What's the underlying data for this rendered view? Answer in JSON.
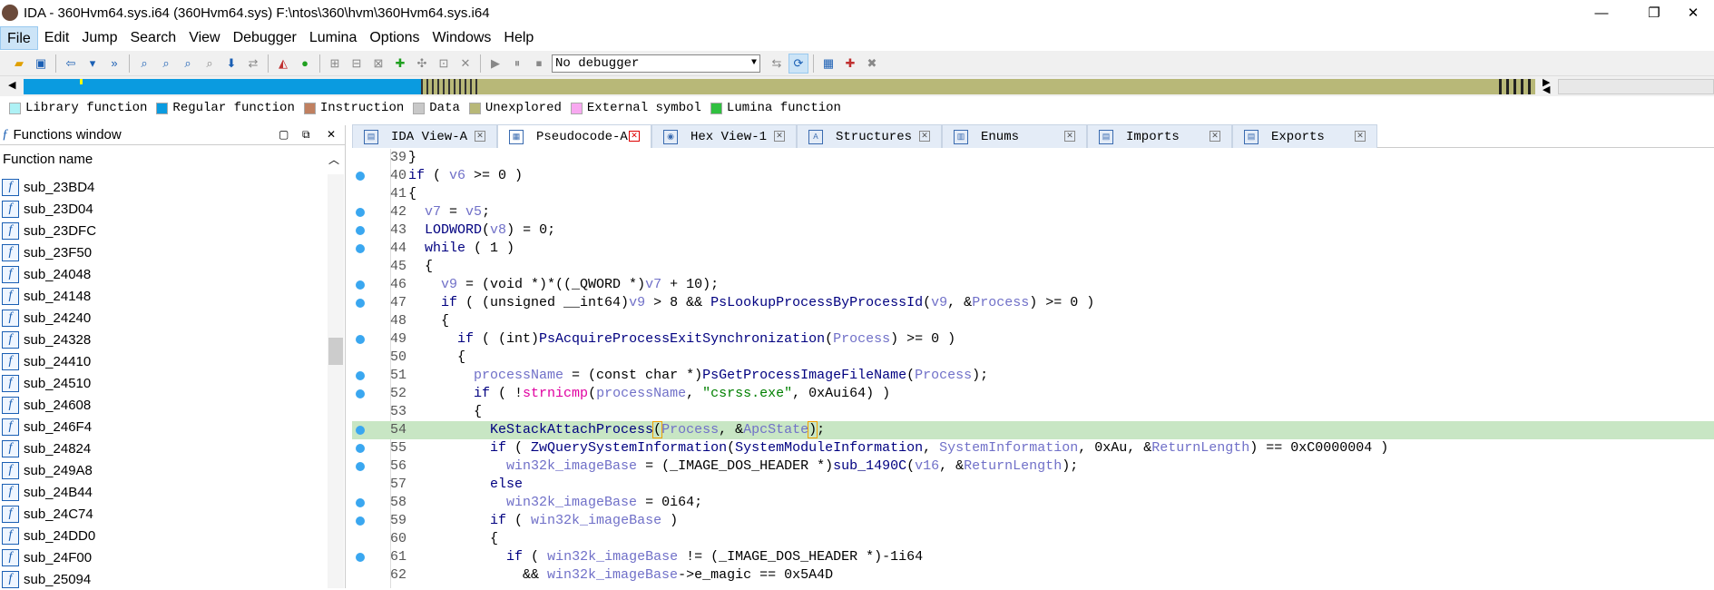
{
  "window": {
    "title": "IDA - 360Hvm64.sys.i64 (360Hvm64.sys) F:\\ntos\\360\\hvm\\360Hvm64.sys.i64",
    "minimize": "—",
    "maximize": "❐",
    "close": "✕"
  },
  "menu": [
    "File",
    "Edit",
    "Jump",
    "Search",
    "View",
    "Debugger",
    "Lumina",
    "Options",
    "Windows",
    "Help"
  ],
  "toolbar": {
    "debugger_select": "No debugger"
  },
  "legend": [
    {
      "label": "Library function",
      "color": "#aef1f5"
    },
    {
      "label": "Regular function",
      "color": "#0a9be0"
    },
    {
      "label": "Instruction",
      "color": "#c08060"
    },
    {
      "label": "Data",
      "color": "#c8c8c8"
    },
    {
      "label": "Unexplored",
      "color": "#b8b878"
    },
    {
      "label": "External symbol",
      "color": "#f8a8f0"
    },
    {
      "label": "Lumina function",
      "color": "#30c040"
    }
  ],
  "functions_window": {
    "title": "Functions window",
    "column": "Function name",
    "items": [
      "sub_23BD4",
      "sub_23D04",
      "sub_23DFC",
      "sub_23F50",
      "sub_24048",
      "sub_24148",
      "sub_24240",
      "sub_24328",
      "sub_24410",
      "sub_24510",
      "sub_24608",
      "sub_246F4",
      "sub_24824",
      "sub_249A8",
      "sub_24B44",
      "sub_24C74",
      "sub_24DD0",
      "sub_24F00",
      "sub_25094"
    ]
  },
  "tabs": [
    {
      "label": "IDA View-A",
      "active": false
    },
    {
      "label": "Pseudocode-A",
      "active": true
    },
    {
      "label": "Hex View-1",
      "active": false
    },
    {
      "label": "Structures",
      "active": false
    },
    {
      "label": "Enums",
      "active": false
    },
    {
      "label": "Imports",
      "active": false
    },
    {
      "label": "Exports",
      "active": false
    }
  ],
  "code_lines": [
    {
      "n": "39",
      "dot": false,
      "html": "}"
    },
    {
      "n": "40",
      "dot": true,
      "html": "<span class='kw'>if</span> ( <span class='vr'>v6</span> &gt;= 0 )"
    },
    {
      "n": "41",
      "dot": false,
      "html": "{"
    },
    {
      "n": "42",
      "dot": true,
      "html": "  <span class='vr'>v7</span> = <span class='vr'>v5</span>;"
    },
    {
      "n": "43",
      "dot": true,
      "html": "  <span class='fnn'>LODWORD</span>(<span class='vr'>v8</span>) = 0;"
    },
    {
      "n": "44",
      "dot": true,
      "html": "  <span class='kw'>while</span> ( 1 )"
    },
    {
      "n": "45",
      "dot": false,
      "html": "  {"
    },
    {
      "n": "46",
      "dot": true,
      "html": "    <span class='vr'>v9</span> = (void *)*((_QWORD *)<span class='vr'>v7</span> + 10);"
    },
    {
      "n": "47",
      "dot": true,
      "html": "    <span class='kw'>if</span> ( (unsigned __int64)<span class='vr'>v9</span> &gt; 8 &amp;&amp; <span class='fnn'>PsLookupProcessByProcessId</span>(<span class='vr'>v9</span>, &amp;<span class='vr'>Process</span>) &gt;= 0 )"
    },
    {
      "n": "48",
      "dot": false,
      "html": "    {"
    },
    {
      "n": "49",
      "dot": true,
      "html": "      <span class='kw'>if</span> ( (int)<span class='fnn'>PsAcquireProcessExitSynchronization</span>(<span class='vr'>Process</span>) &gt;= 0 )"
    },
    {
      "n": "50",
      "dot": false,
      "html": "      {"
    },
    {
      "n": "51",
      "dot": true,
      "html": "        <span class='vr'>processName</span> = (const char *)<span class='fnn'>PsGetProcessImageFileName</span>(<span class='vr'>Process</span>);"
    },
    {
      "n": "52",
      "dot": true,
      "html": "        <span class='kw'>if</span> ( !<span class='pk'>strnicmp</span>(<span class='vr'>processName</span>, <span class='st'>\"csrss.exe\"</span>, 0xAui64) )"
    },
    {
      "n": "53",
      "dot": false,
      "html": "        {"
    },
    {
      "n": "54",
      "dot": true,
      "hl": true,
      "html": "          <span class='fnn'>KeStackAttachProcess</span><span class='cur'>(</span><span class='vr'>Process</span>, &amp;<span class='vr'>ApcState</span><span class='cur'>)</span>;"
    },
    {
      "n": "55",
      "dot": true,
      "html": "          <span class='kw'>if</span> ( <span class='fnn'>ZwQuerySystemInformation</span>(<span class='fnn'>SystemModuleInformation</span>, <span class='vr'>SystemInformation</span>, 0xAu, &amp;<span class='vr'>ReturnLength</span>) == 0xC0000004 )"
    },
    {
      "n": "56",
      "dot": true,
      "html": "            <span class='vr'>win32k_imageBase</span> = (_IMAGE_DOS_HEADER *)<span class='fnn'>sub_1490C</span>(<span class='vr'>v16</span>, &amp;<span class='vr'>ReturnLength</span>);"
    },
    {
      "n": "57",
      "dot": false,
      "html": "          <span class='kw'>else</span>"
    },
    {
      "n": "58",
      "dot": true,
      "html": "            <span class='vr'>win32k_imageBase</span> = 0i64;"
    },
    {
      "n": "59",
      "dot": true,
      "html": "          <span class='kw'>if</span> ( <span class='vr'>win32k_imageBase</span> )"
    },
    {
      "n": "60",
      "dot": false,
      "html": "          {"
    },
    {
      "n": "61",
      "dot": true,
      "html": "            <span class='kw'>if</span> ( <span class='vr'>win32k_imageBase</span> != (_IMAGE_DOS_HEADER *)-1i64"
    },
    {
      "n": "62",
      "dot": false,
      "html": "              &amp;&amp; <span class='vr'>win32k_imageBase</span>-&gt;e_magic == 0x5A4D"
    }
  ]
}
